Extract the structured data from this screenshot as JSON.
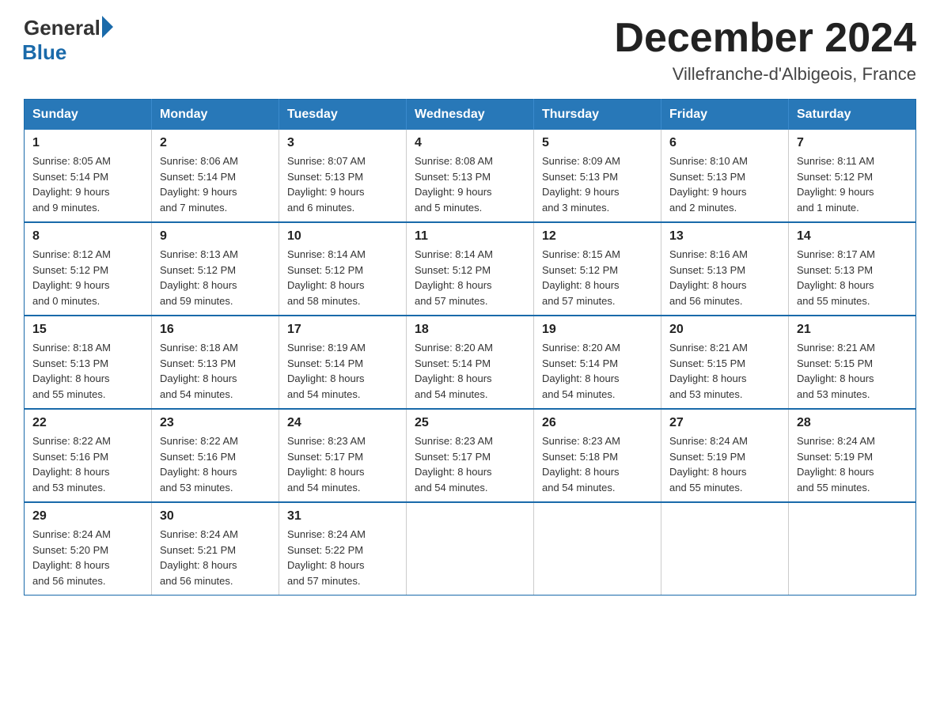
{
  "logo": {
    "general": "General",
    "blue": "Blue"
  },
  "title": "December 2024",
  "location": "Villefranche-d'Albigeois, France",
  "days_header": [
    "Sunday",
    "Monday",
    "Tuesday",
    "Wednesday",
    "Thursday",
    "Friday",
    "Saturday"
  ],
  "weeks": [
    [
      {
        "day": "1",
        "info": "Sunrise: 8:05 AM\nSunset: 5:14 PM\nDaylight: 9 hours\nand 9 minutes."
      },
      {
        "day": "2",
        "info": "Sunrise: 8:06 AM\nSunset: 5:14 PM\nDaylight: 9 hours\nand 7 minutes."
      },
      {
        "day": "3",
        "info": "Sunrise: 8:07 AM\nSunset: 5:13 PM\nDaylight: 9 hours\nand 6 minutes."
      },
      {
        "day": "4",
        "info": "Sunrise: 8:08 AM\nSunset: 5:13 PM\nDaylight: 9 hours\nand 5 minutes."
      },
      {
        "day": "5",
        "info": "Sunrise: 8:09 AM\nSunset: 5:13 PM\nDaylight: 9 hours\nand 3 minutes."
      },
      {
        "day": "6",
        "info": "Sunrise: 8:10 AM\nSunset: 5:13 PM\nDaylight: 9 hours\nand 2 minutes."
      },
      {
        "day": "7",
        "info": "Sunrise: 8:11 AM\nSunset: 5:12 PM\nDaylight: 9 hours\nand 1 minute."
      }
    ],
    [
      {
        "day": "8",
        "info": "Sunrise: 8:12 AM\nSunset: 5:12 PM\nDaylight: 9 hours\nand 0 minutes."
      },
      {
        "day": "9",
        "info": "Sunrise: 8:13 AM\nSunset: 5:12 PM\nDaylight: 8 hours\nand 59 minutes."
      },
      {
        "day": "10",
        "info": "Sunrise: 8:14 AM\nSunset: 5:12 PM\nDaylight: 8 hours\nand 58 minutes."
      },
      {
        "day": "11",
        "info": "Sunrise: 8:14 AM\nSunset: 5:12 PM\nDaylight: 8 hours\nand 57 minutes."
      },
      {
        "day": "12",
        "info": "Sunrise: 8:15 AM\nSunset: 5:12 PM\nDaylight: 8 hours\nand 57 minutes."
      },
      {
        "day": "13",
        "info": "Sunrise: 8:16 AM\nSunset: 5:13 PM\nDaylight: 8 hours\nand 56 minutes."
      },
      {
        "day": "14",
        "info": "Sunrise: 8:17 AM\nSunset: 5:13 PM\nDaylight: 8 hours\nand 55 minutes."
      }
    ],
    [
      {
        "day": "15",
        "info": "Sunrise: 8:18 AM\nSunset: 5:13 PM\nDaylight: 8 hours\nand 55 minutes."
      },
      {
        "day": "16",
        "info": "Sunrise: 8:18 AM\nSunset: 5:13 PM\nDaylight: 8 hours\nand 54 minutes."
      },
      {
        "day": "17",
        "info": "Sunrise: 8:19 AM\nSunset: 5:14 PM\nDaylight: 8 hours\nand 54 minutes."
      },
      {
        "day": "18",
        "info": "Sunrise: 8:20 AM\nSunset: 5:14 PM\nDaylight: 8 hours\nand 54 minutes."
      },
      {
        "day": "19",
        "info": "Sunrise: 8:20 AM\nSunset: 5:14 PM\nDaylight: 8 hours\nand 54 minutes."
      },
      {
        "day": "20",
        "info": "Sunrise: 8:21 AM\nSunset: 5:15 PM\nDaylight: 8 hours\nand 53 minutes."
      },
      {
        "day": "21",
        "info": "Sunrise: 8:21 AM\nSunset: 5:15 PM\nDaylight: 8 hours\nand 53 minutes."
      }
    ],
    [
      {
        "day": "22",
        "info": "Sunrise: 8:22 AM\nSunset: 5:16 PM\nDaylight: 8 hours\nand 53 minutes."
      },
      {
        "day": "23",
        "info": "Sunrise: 8:22 AM\nSunset: 5:16 PM\nDaylight: 8 hours\nand 53 minutes."
      },
      {
        "day": "24",
        "info": "Sunrise: 8:23 AM\nSunset: 5:17 PM\nDaylight: 8 hours\nand 54 minutes."
      },
      {
        "day": "25",
        "info": "Sunrise: 8:23 AM\nSunset: 5:17 PM\nDaylight: 8 hours\nand 54 minutes."
      },
      {
        "day": "26",
        "info": "Sunrise: 8:23 AM\nSunset: 5:18 PM\nDaylight: 8 hours\nand 54 minutes."
      },
      {
        "day": "27",
        "info": "Sunrise: 8:24 AM\nSunset: 5:19 PM\nDaylight: 8 hours\nand 55 minutes."
      },
      {
        "day": "28",
        "info": "Sunrise: 8:24 AM\nSunset: 5:19 PM\nDaylight: 8 hours\nand 55 minutes."
      }
    ],
    [
      {
        "day": "29",
        "info": "Sunrise: 8:24 AM\nSunset: 5:20 PM\nDaylight: 8 hours\nand 56 minutes."
      },
      {
        "day": "30",
        "info": "Sunrise: 8:24 AM\nSunset: 5:21 PM\nDaylight: 8 hours\nand 56 minutes."
      },
      {
        "day": "31",
        "info": "Sunrise: 8:24 AM\nSunset: 5:22 PM\nDaylight: 8 hours\nand 57 minutes."
      },
      null,
      null,
      null,
      null
    ]
  ]
}
